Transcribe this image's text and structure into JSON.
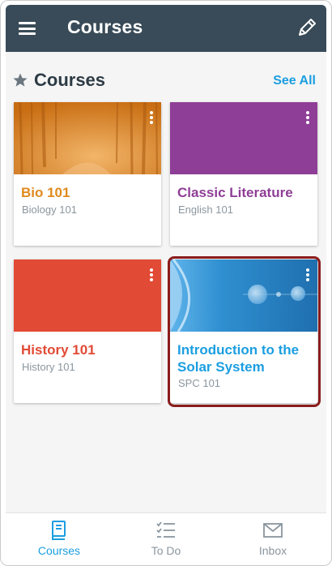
{
  "header": {
    "title": "Courses",
    "menu_icon": "hamburger-menu-icon",
    "edit_icon": "pencil-icon"
  },
  "section": {
    "title": "Courses",
    "see_all": "See All",
    "star_icon": "star-icon"
  },
  "courses": [
    {
      "name": "Bio 101",
      "code": "Biology 101",
      "color": "#e08a1e"
    },
    {
      "name": "Classic Literature",
      "code": "English 101",
      "color": "#8f3e97"
    },
    {
      "name": "History 101",
      "code": "History 101",
      "color": "#e14a35"
    },
    {
      "name": "Introduction to the Solar System",
      "code": "SPC 101",
      "color": "#1b9ee0"
    }
  ],
  "bottom_nav": [
    {
      "label": "Courses",
      "icon": "book-icon",
      "active": true
    },
    {
      "label": "To Do",
      "icon": "checklist-icon",
      "active": false
    },
    {
      "label": "Inbox",
      "icon": "envelope-icon",
      "active": false
    }
  ],
  "colors": {
    "header_bg": "#394b58",
    "accent": "#1b9ee0",
    "highlight_border": "#8b1c1c"
  }
}
